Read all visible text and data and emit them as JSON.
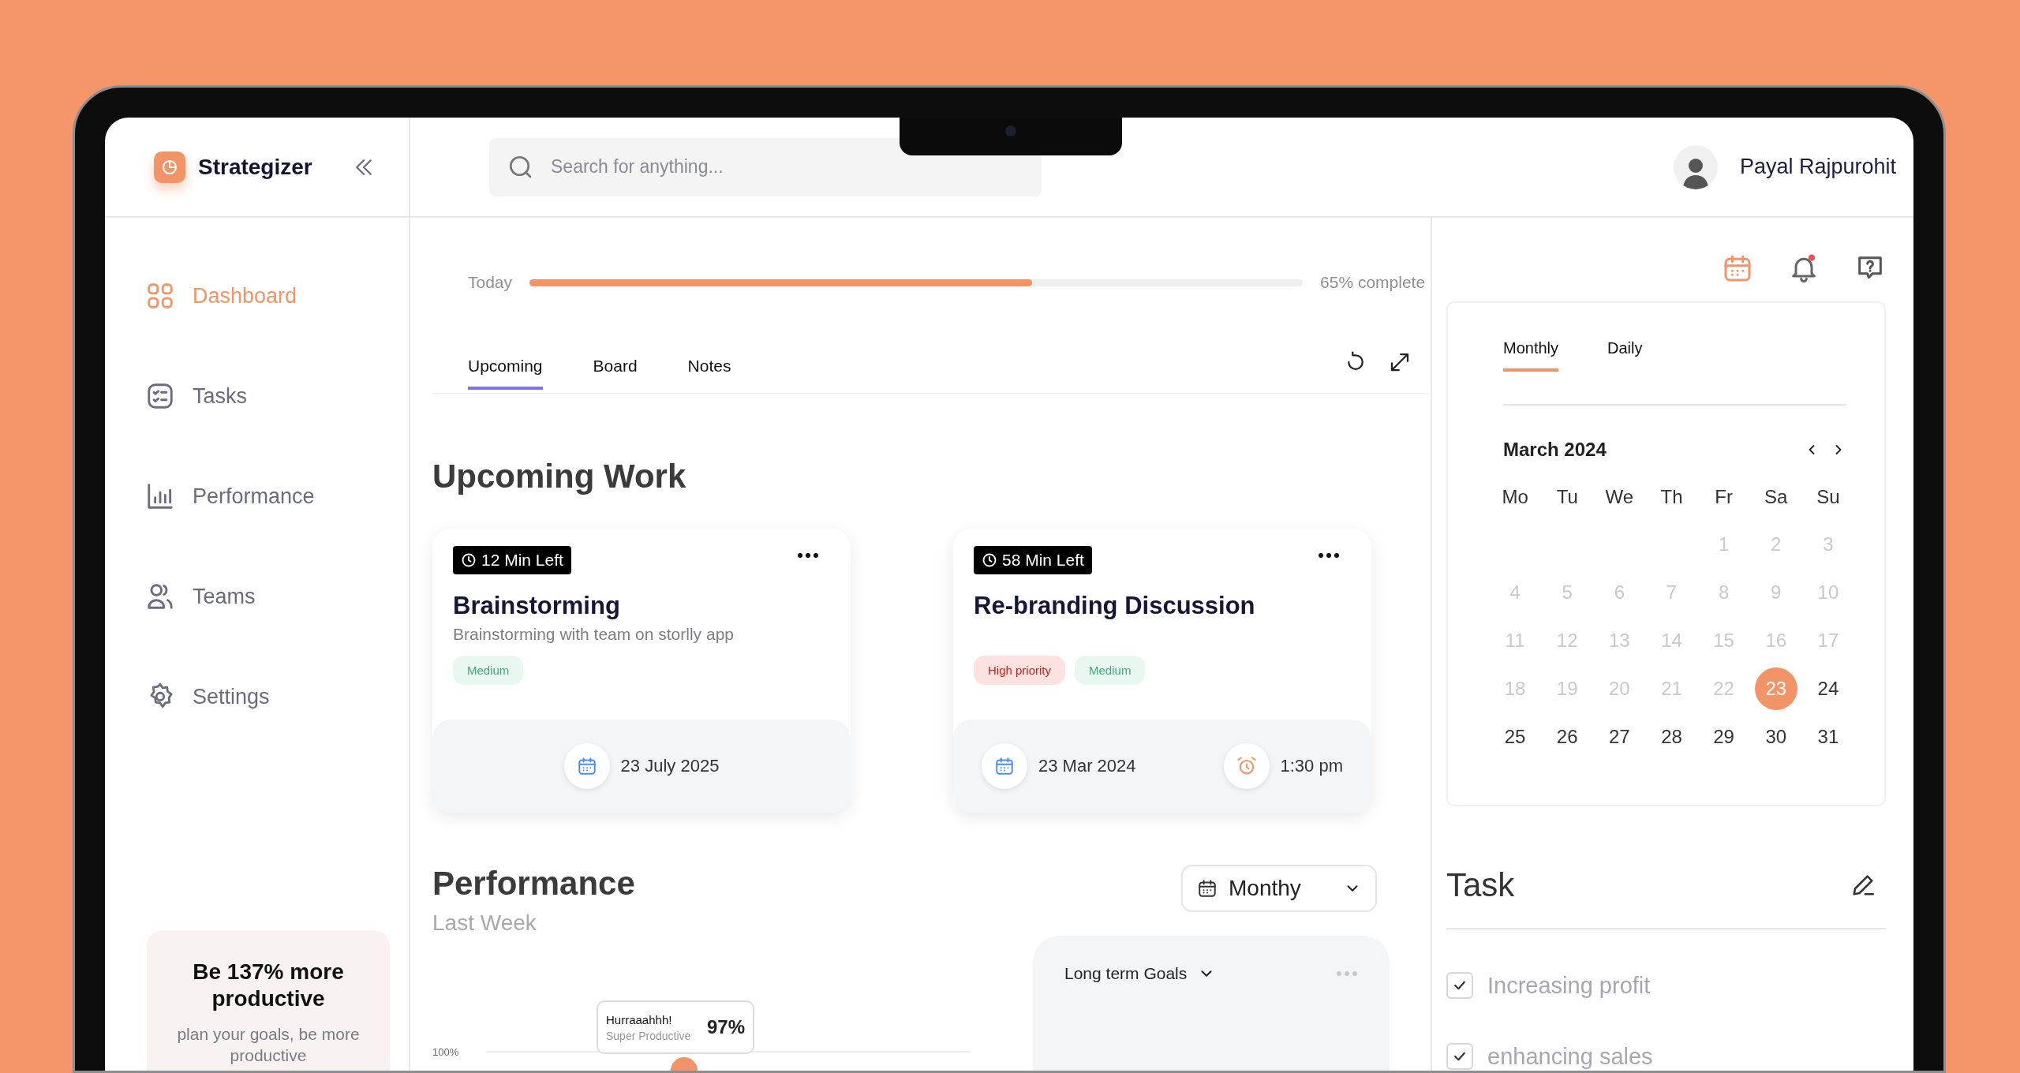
{
  "brand": {
    "name": "Strategizer"
  },
  "nav": [
    {
      "label": "Dashboard",
      "kind": "grid",
      "selected": true
    },
    {
      "label": "Tasks",
      "kind": "tasks",
      "selected": false
    },
    {
      "label": "Performance",
      "kind": "chart",
      "selected": false
    },
    {
      "label": "Teams",
      "kind": "users",
      "selected": false
    },
    {
      "label": "Settings",
      "kind": "gear",
      "selected": false
    }
  ],
  "promo": {
    "title": "Be 137% more productive",
    "text": "plan your goals, be more productive"
  },
  "search": {
    "placeholder": "Search for anything..."
  },
  "user": {
    "name": "Payal Rajpurohit"
  },
  "progress": {
    "label": "Today",
    "level": 0.65,
    "reading": "65% complete"
  },
  "tabs": [
    {
      "label": "Upcoming",
      "selected": true
    },
    {
      "label": "Board",
      "selected": false
    },
    {
      "label": "Notes",
      "selected": false
    }
  ],
  "upcoming": {
    "title": "Upcoming Work",
    "cards": [
      {
        "time_left": "12 Min Left",
        "title": "Brainstorming",
        "description": "Brainstorming with team on storlly app",
        "tags": [
          {
            "label": "Medium",
            "kind": "medium"
          }
        ],
        "date": "23 July 2025"
      },
      {
        "time_left": "58 Min Left",
        "title": "Re-branding Discussion",
        "tags": [
          {
            "label": "High priority",
            "kind": "high"
          },
          {
            "label": "Medium",
            "kind": "medium"
          }
        ],
        "date": "23 Mar 2024",
        "time": "1:30 pm"
      }
    ]
  },
  "performance": {
    "title": "Performance",
    "subtitle": "Last Week",
    "period": "Monthy",
    "chart": {
      "y_label": "100%",
      "tooltip": {
        "title": "Hurraaahhh!",
        "subtitle": "Super Productive",
        "value": "97%"
      }
    },
    "goals": {
      "title": "Long term Goals"
    }
  },
  "notifications": {
    "unread": true
  },
  "calendar": {
    "tabs": [
      {
        "label": "Monthly",
        "selected": true
      },
      {
        "label": "Daily",
        "selected": false
      }
    ],
    "month": "March 2024",
    "weekdays": [
      "Mo",
      "Tu",
      "We",
      "Th",
      "Fr",
      "Sa",
      "Su"
    ],
    "weeks": [
      [
        {
          "day": "1",
          "past": true,
          "selected": false
        },
        {
          "day": "2",
          "past": true,
          "selected": false
        },
        {
          "day": "3",
          "past": true,
          "selected": false
        }
      ],
      [
        {
          "day": "4",
          "past": true,
          "selected": false
        },
        {
          "day": "5",
          "past": true,
          "selected": false
        },
        {
          "day": "6",
          "past": true,
          "selected": false
        },
        {
          "day": "7",
          "past": true,
          "selected": false
        },
        {
          "day": "8",
          "past": true,
          "selected": false
        },
        {
          "day": "9",
          "past": true,
          "selected": false
        },
        {
          "day": "10",
          "past": true,
          "selected": false
        }
      ],
      [
        {
          "day": "11",
          "past": true,
          "selected": false
        },
        {
          "day": "12",
          "past": true,
          "selected": false
        },
        {
          "day": "13",
          "past": true,
          "selected": false
        },
        {
          "day": "14",
          "past": true,
          "selected": false
        },
        {
          "day": "15",
          "past": true,
          "selected": false
        },
        {
          "day": "16",
          "past": true,
          "selected": false
        },
        {
          "day": "17",
          "past": true,
          "selected": false
        }
      ],
      [
        {
          "day": "18",
          "past": true,
          "selected": false
        },
        {
          "day": "19",
          "past": true,
          "selected": false
        },
        {
          "day": "20",
          "past": true,
          "selected": false
        },
        {
          "day": "21",
          "past": true,
          "selected": false
        },
        {
          "day": "22",
          "past": true,
          "selected": false
        },
        {
          "day": "23",
          "past": false,
          "selected": true
        },
        {
          "day": "24",
          "past": false,
          "selected": false
        }
      ],
      [
        {
          "day": "25",
          "past": false,
          "selected": false
        },
        {
          "day": "26",
          "past": false,
          "selected": false
        },
        {
          "day": "27",
          "past": false,
          "selected": false
        },
        {
          "day": "28",
          "past": false,
          "selected": false
        },
        {
          "day": "29",
          "past": false,
          "selected": false
        },
        {
          "day": "30",
          "past": false,
          "selected": false
        },
        {
          "day": "31",
          "past": false,
          "selected": false
        }
      ]
    ]
  },
  "task": {
    "title": "Task",
    "items": [
      {
        "label": "Increasing profit",
        "checked": true
      },
      {
        "label": "enhancing sales",
        "checked": true
      }
    ]
  }
}
